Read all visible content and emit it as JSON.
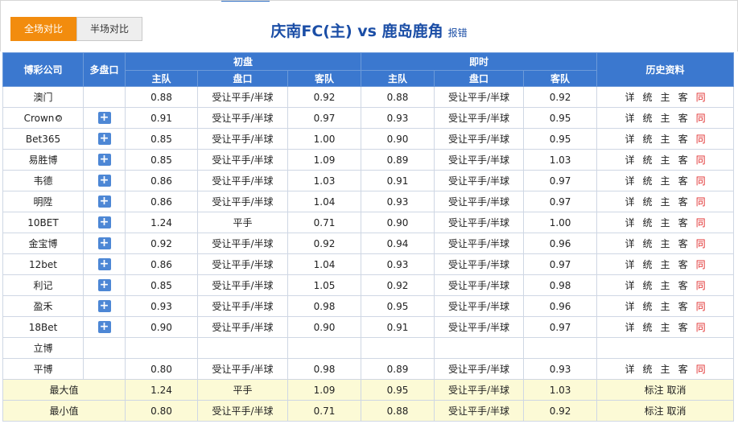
{
  "tabs": [
    {
      "label": "全场对比",
      "active": true
    },
    {
      "label": "半场对比",
      "active": false
    }
  ],
  "match": {
    "title": "庆南FC(主) vs 鹿岛鹿角",
    "report": "报错"
  },
  "headers": {
    "company": "博彩公司",
    "multi": "多盘口",
    "initial": "初盘",
    "live": "即时",
    "history": "历史资料",
    "home": "主队",
    "handicap": "盘口",
    "away": "客队"
  },
  "history_links": [
    "详",
    "统",
    "主",
    "客",
    "同"
  ],
  "rows": [
    {
      "company": "澳门",
      "plus": false,
      "i_home": "0.88",
      "i_line": "受让平手/半球",
      "i_away": "0.92",
      "l_home": "0.88",
      "l_line": "受让平手/半球",
      "l_away": "0.92"
    },
    {
      "company": "Crown",
      "ball": true,
      "plus": true,
      "i_home": "0.91",
      "i_line": "受让平手/半球",
      "i_away": "0.97",
      "l_home": "0.93",
      "l_line": "受让平手/半球",
      "l_away": "0.95"
    },
    {
      "company": "Bet365",
      "plus": true,
      "i_home": "0.85",
      "i_line": "受让平手/半球",
      "i_away": "1.00",
      "l_home": "0.90",
      "l_line": "受让平手/半球",
      "l_away": "0.95"
    },
    {
      "company": "易胜博",
      "plus": true,
      "i_home": "0.85",
      "i_line": "受让平手/半球",
      "i_away": "1.09",
      "l_home": "0.89",
      "l_line": "受让平手/半球",
      "l_away": "1.03"
    },
    {
      "company": "韦德",
      "plus": true,
      "i_home": "0.86",
      "i_line": "受让平手/半球",
      "i_away": "1.03",
      "l_home": "0.91",
      "l_line": "受让平手/半球",
      "l_away": "0.97"
    },
    {
      "company": "明陞",
      "plus": true,
      "i_home": "0.86",
      "i_line": "受让平手/半球",
      "i_away": "1.04",
      "l_home": "0.93",
      "l_line": "受让平手/半球",
      "l_away": "0.97"
    },
    {
      "company": "10BET",
      "plus": true,
      "i_home": "1.24",
      "i_line": "平手",
      "i_away": "0.71",
      "l_home": "0.90",
      "l_line": "受让平手/半球",
      "l_away": "1.00"
    },
    {
      "company": "金宝博",
      "plus": true,
      "i_home": "0.92",
      "i_line": "受让平手/半球",
      "i_away": "0.92",
      "l_home": "0.94",
      "l_line": "受让平手/半球",
      "l_away": "0.96"
    },
    {
      "company": "12bet",
      "plus": true,
      "i_home": "0.86",
      "i_line": "受让平手/半球",
      "i_away": "1.04",
      "l_home": "0.93",
      "l_line": "受让平手/半球",
      "l_away": "0.97"
    },
    {
      "company": "利记",
      "plus": true,
      "i_home": "0.85",
      "i_line": "受让平手/半球",
      "i_away": "1.05",
      "l_home": "0.92",
      "l_line": "受让平手/半球",
      "l_away": "0.98"
    },
    {
      "company": "盈禾",
      "plus": true,
      "i_home": "0.93",
      "i_line": "受让平手/半球",
      "i_away": "0.98",
      "l_home": "0.95",
      "l_line": "受让平手/半球",
      "l_away": "0.96"
    },
    {
      "company": "18Bet",
      "plus": true,
      "i_home": "0.90",
      "i_line": "受让平手/半球",
      "i_away": "0.90",
      "l_home": "0.91",
      "l_line": "受让平手/半球",
      "l_away": "0.97"
    },
    {
      "company": "立博",
      "plus": false,
      "empty": true,
      "i_home": "",
      "i_line": "",
      "i_away": "",
      "l_home": "",
      "l_line": "",
      "l_away": ""
    },
    {
      "company": "平博",
      "plus": false,
      "i_home": "0.80",
      "i_line": "受让平手/半球",
      "i_away": "0.98",
      "l_home": "0.89",
      "l_line": "受让平手/半球",
      "l_away": "0.93"
    }
  ],
  "stats": [
    {
      "label": "最大值",
      "i_home": "1.24",
      "i_line": "平手",
      "i_away": "1.09",
      "l_home": "0.95",
      "l_line": "受让平手/半球",
      "l_away": "1.03",
      "actions": "标注 取消"
    },
    {
      "label": "最小值",
      "i_home": "0.80",
      "i_line": "受让平手/半球",
      "i_away": "0.71",
      "l_home": "0.88",
      "l_line": "受让平手/半球",
      "l_away": "0.92",
      "actions": "标注 取消"
    }
  ]
}
